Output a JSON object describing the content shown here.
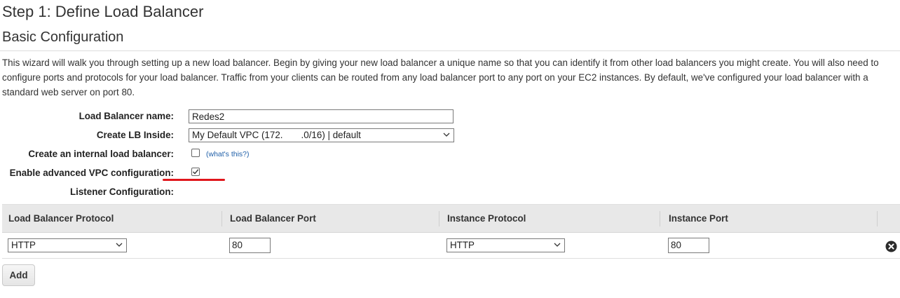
{
  "page": {
    "step_title": "Step 1: Define Load Balancer",
    "section_title": "Basic Configuration",
    "intro": "This wizard will walk you through setting up a new load balancer. Begin by giving your new load balancer a unique name so that you can identify it from other load balancers you might create. You will also need to configure ports and protocols for your load balancer. Traffic from your clients can be routed from any load balancer port to any port on your EC2 instances. By default, we've configured your load balancer with a standard web server on port 80."
  },
  "form": {
    "name_label": "Load Balancer name:",
    "name_value": "Redes2",
    "create_inside_label": "Create LB Inside:",
    "create_inside_value": "My Default VPC (172.       .0/16) | default",
    "internal_label": "Create an internal load balancer:",
    "internal_checked": false,
    "help_link": "(what's this?)",
    "advanced_vpc_label": "Enable advanced VPC configuration:",
    "advanced_vpc_checked": true,
    "listener_label": "Listener Configuration:"
  },
  "listener_table": {
    "headers": [
      "Load Balancer Protocol",
      "Load Balancer Port",
      "Instance Protocol",
      "Instance Port"
    ],
    "rows": [
      {
        "lb_protocol": "HTTP",
        "lb_port": "80",
        "instance_protocol": "HTTP",
        "instance_port": "80"
      }
    ]
  },
  "actions": {
    "add_label": "Add"
  },
  "colors": {
    "annotation_underline": "#e0161c",
    "link": "#1f5fa8",
    "header_bg": "#e8e8e8"
  }
}
